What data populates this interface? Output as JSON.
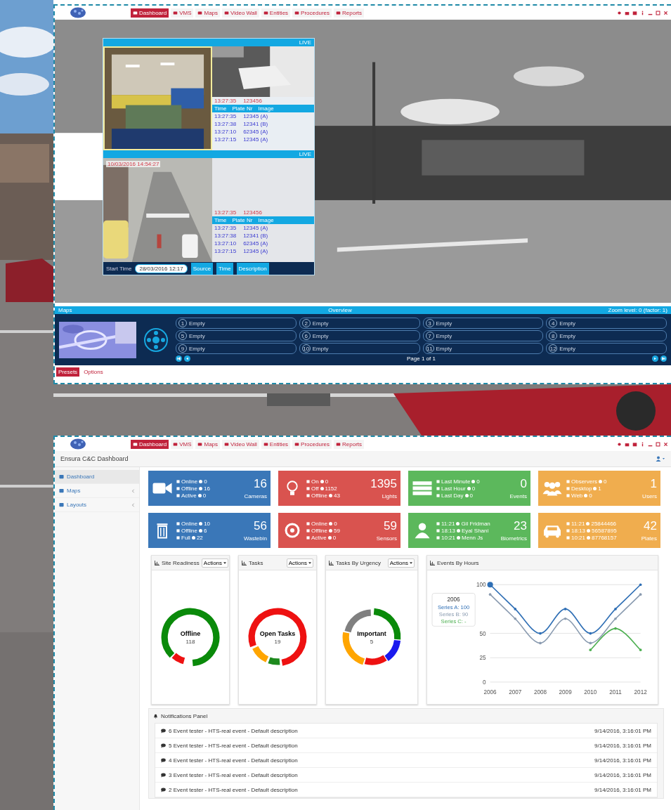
{
  "ops_window": {
    "nav": [
      {
        "label": "Dashboard",
        "selected": true
      },
      {
        "label": "VMS",
        "selected": false
      },
      {
        "label": "Maps",
        "selected": false
      },
      {
        "label": "Video Wall",
        "selected": false
      },
      {
        "label": "Entities",
        "selected": false
      },
      {
        "label": "Procedures",
        "selected": false
      },
      {
        "label": "Reports",
        "selected": false
      }
    ],
    "video_wall": {
      "panels": [
        {
          "badge": "LIVE",
          "plate_time": "13:27:35",
          "plate_no": "123456",
          "columns": [
            "Time",
            "Plate Nr",
            "Image"
          ],
          "rows": [
            [
              "13:27:35",
              "12345 (A)"
            ],
            [
              "13:27:38",
              "12341 (B)"
            ],
            [
              "13:27:10",
              "62345 (A)"
            ],
            [
              "13:27:15",
              "12345 (A)"
            ]
          ]
        },
        {
          "badge": "LIVE",
          "timestamp": "10/03/2016 14:54:27",
          "plate_time": "13:27:35",
          "plate_no": "123456",
          "columns": [
            "Time",
            "Plate Nr",
            "Image"
          ],
          "rows": [
            [
              "13:27:35",
              "12345 (A)"
            ],
            [
              "13:27:38",
              "12341 (B)"
            ],
            [
              "13:27:10",
              "62345 (A)"
            ],
            [
              "13:27:15",
              "12345 (A)"
            ]
          ]
        }
      ],
      "start_label": "Start Time",
      "start_value": "28/03/2016 12:17",
      "log_columns": [
        "Source",
        "Time",
        "Description"
      ]
    },
    "maps": {
      "title": "Maps",
      "center": "Overview",
      "zoom": "Zoom level: 0 (factor: 1)",
      "page": "Page 1 of 1",
      "slots": [
        {
          "number": "1",
          "label": "Empty"
        },
        {
          "number": "2",
          "label": "Empty"
        },
        {
          "number": "3",
          "label": "Empty"
        },
        {
          "number": "4",
          "label": "Empty"
        },
        {
          "number": "5",
          "label": "Empty"
        },
        {
          "number": "6",
          "label": "Empty"
        },
        {
          "number": "7",
          "label": "Empty"
        },
        {
          "number": "8",
          "label": "Empty"
        },
        {
          "number": "9",
          "label": "Empty"
        },
        {
          "number": "10",
          "label": "Empty"
        },
        {
          "number": "11",
          "label": "Empty"
        },
        {
          "number": "12",
          "label": "Empty"
        }
      ]
    },
    "tabs": [
      {
        "label": "Presets",
        "selected": true
      },
      {
        "label": "Options",
        "selected": false
      }
    ]
  },
  "dashboard_window": {
    "nav": [
      {
        "label": "Dashboard",
        "selected": true
      },
      {
        "label": "VMS",
        "selected": false
      },
      {
        "label": "Maps",
        "selected": false
      },
      {
        "label": "Video Wall",
        "selected": false
      },
      {
        "label": "Entities",
        "selected": false
      },
      {
        "label": "Procedures",
        "selected": false
      },
      {
        "label": "Reports",
        "selected": false
      }
    ],
    "title": "Ensura C&C Dashboard",
    "sidebar": [
      {
        "label": "Dashboard",
        "selected": true,
        "expandable": false
      },
      {
        "label": "Maps",
        "selected": false,
        "expandable": true
      },
      {
        "label": "Layouts",
        "selected": false,
        "expandable": true
      }
    ],
    "tiles": [
      {
        "kind": "camera",
        "color": "#3a77b8",
        "value": "16",
        "label": "Cameras",
        "lines": [
          {
            "label": "Online",
            "count": "0"
          },
          {
            "label": "Offline",
            "count": "16"
          },
          {
            "label": "Active",
            "count": "0"
          }
        ]
      },
      {
        "kind": "bulb",
        "color": "#d9534f",
        "value": "1395",
        "label": "Lights",
        "lines": [
          {
            "label": "On",
            "count": "0"
          },
          {
            "label": "Off",
            "count": "1152"
          },
          {
            "label": "Offline",
            "count": "43"
          }
        ]
      },
      {
        "kind": "server",
        "color": "#5cb85c",
        "value": "0",
        "label": "Events",
        "lines": [
          {
            "label": "Last Minute",
            "count": "0"
          },
          {
            "label": "Last Hour",
            "count": "0"
          },
          {
            "label": "Last Day",
            "count": "0"
          }
        ]
      },
      {
        "kind": "users",
        "color": "#f0ad4e",
        "value": "1",
        "label": "Users",
        "lines": [
          {
            "label": "Observers",
            "count": "0"
          },
          {
            "label": "Desktop",
            "count": "1"
          },
          {
            "label": "Web",
            "count": "0"
          }
        ]
      },
      {
        "kind": "trash",
        "color": "#3a77b8",
        "value": "56",
        "label": "Wastebin",
        "lines": [
          {
            "label": "Online",
            "count": "10"
          },
          {
            "label": "Offline",
            "count": "6"
          },
          {
            "label": "Full",
            "count": "22"
          }
        ]
      },
      {
        "kind": "target",
        "color": "#d9534f",
        "value": "59",
        "label": "Sensors",
        "lines": [
          {
            "label": "Online",
            "count": "0"
          },
          {
            "label": "Offline",
            "count": "59"
          },
          {
            "label": "Active",
            "count": "0"
          }
        ]
      },
      {
        "kind": "person",
        "color": "#5cb85c",
        "value": "23",
        "label": "Biometrics",
        "lines": [
          {
            "label": "11:21",
            "count": "Gil Fridman"
          },
          {
            "label": "18:13",
            "count": "Eyal Shani"
          },
          {
            "label": "10:21",
            "count": "Menn Js"
          }
        ]
      },
      {
        "kind": "car",
        "color": "#f0ad4e",
        "value": "42",
        "label": "Plates",
        "lines": [
          {
            "label": "11:21",
            "count": "25844466"
          },
          {
            "label": "18:13",
            "count": "56587895"
          },
          {
            "label": "10:21",
            "count": "87768157"
          }
        ]
      }
    ],
    "panels": [
      {
        "title": "Site Readiness",
        "actions": "Actions",
        "center": "Offline",
        "count": "118"
      },
      {
        "title": "Tasks",
        "actions": "Actions",
        "center": "Open Tasks",
        "count": "19"
      },
      {
        "title": "Tasks By Urgency",
        "actions": "Actions",
        "center": "Important",
        "count": "5"
      }
    ],
    "events_chart": {
      "title": "Events By Hours",
      "tooltip": {
        "title": "2006",
        "values": [
          ": 100",
          ": 90",
          ": -"
        ]
      },
      "chart_data": {
        "type": "line",
        "x": [
          "2006",
          "2007",
          "2008",
          "2009",
          "2010",
          "2011",
          "2012"
        ],
        "ylim": [
          0,
          100
        ],
        "yticks": [
          0,
          25,
          50,
          100
        ],
        "series": [
          {
            "name": "Series A",
            "color": "#2f6fb5",
            "values": [
              100,
              75,
              50,
              75,
              50,
              75,
              100
            ]
          },
          {
            "name": "Series B",
            "color": "#8a9bb0",
            "values": [
              90,
              65,
              40,
              65,
              40,
              65,
              90
            ]
          },
          {
            "name": "Series C",
            "color": "#4caf50",
            "values": [
              null,
              null,
              null,
              null,
              33,
              55,
              33
            ]
          }
        ]
      }
    },
    "notifications": {
      "title": "Notifications Panel",
      "items": [
        {
          "text": "6 Event tester - HTS-real event - Default description",
          "time": "9/14/2016, 3:16:01 PM"
        },
        {
          "text": "5 Event tester - HTS-real event - Default description",
          "time": "9/14/2016, 3:16:01 PM"
        },
        {
          "text": "4 Event tester - HTS-real event - Default description",
          "time": "9/14/2016, 3:16:01 PM"
        },
        {
          "text": "3 Event tester - HTS-real event - Default description",
          "time": "9/14/2016, 3:16:01 PM"
        },
        {
          "text": "2 Event tester - HTS-real event - Default description",
          "time": "9/14/2016, 3:16:01 PM"
        }
      ]
    }
  }
}
